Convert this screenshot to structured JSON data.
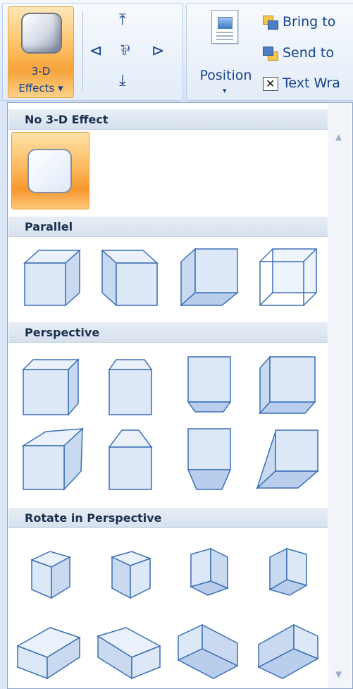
{
  "ribbon": {
    "effects_button": {
      "line1": "3-D",
      "line2": "Effects ▾"
    },
    "tilt_icons": {
      "up": "tilt-up-icon",
      "left": "tilt-left-icon",
      "toggle": "3d-on-off-icon",
      "right": "tilt-right-icon",
      "down": "tilt-down-icon"
    },
    "position_button": {
      "label": "Position",
      "arrow": "▾"
    },
    "arrange": [
      {
        "label": "Bring to",
        "icon": "bring-to-front-icon"
      },
      {
        "label": "Send to",
        "icon": "send-to-back-icon"
      },
      {
        "label": "Text Wra",
        "icon": "text-wrap-icon"
      }
    ]
  },
  "gallery": {
    "sections": [
      {
        "title": "No 3-D Effect"
      },
      {
        "title": "Parallel"
      },
      {
        "title": "Perspective"
      },
      {
        "title": "Rotate in Perspective"
      }
    ],
    "scroll_up": "▲",
    "scroll_down": "▼"
  },
  "colors": {
    "accent_orange": "#fbb85a",
    "header_bg": "#dce6f2",
    "shape_fill": "#dce8f8",
    "shape_stroke": "#3b6fb6"
  }
}
